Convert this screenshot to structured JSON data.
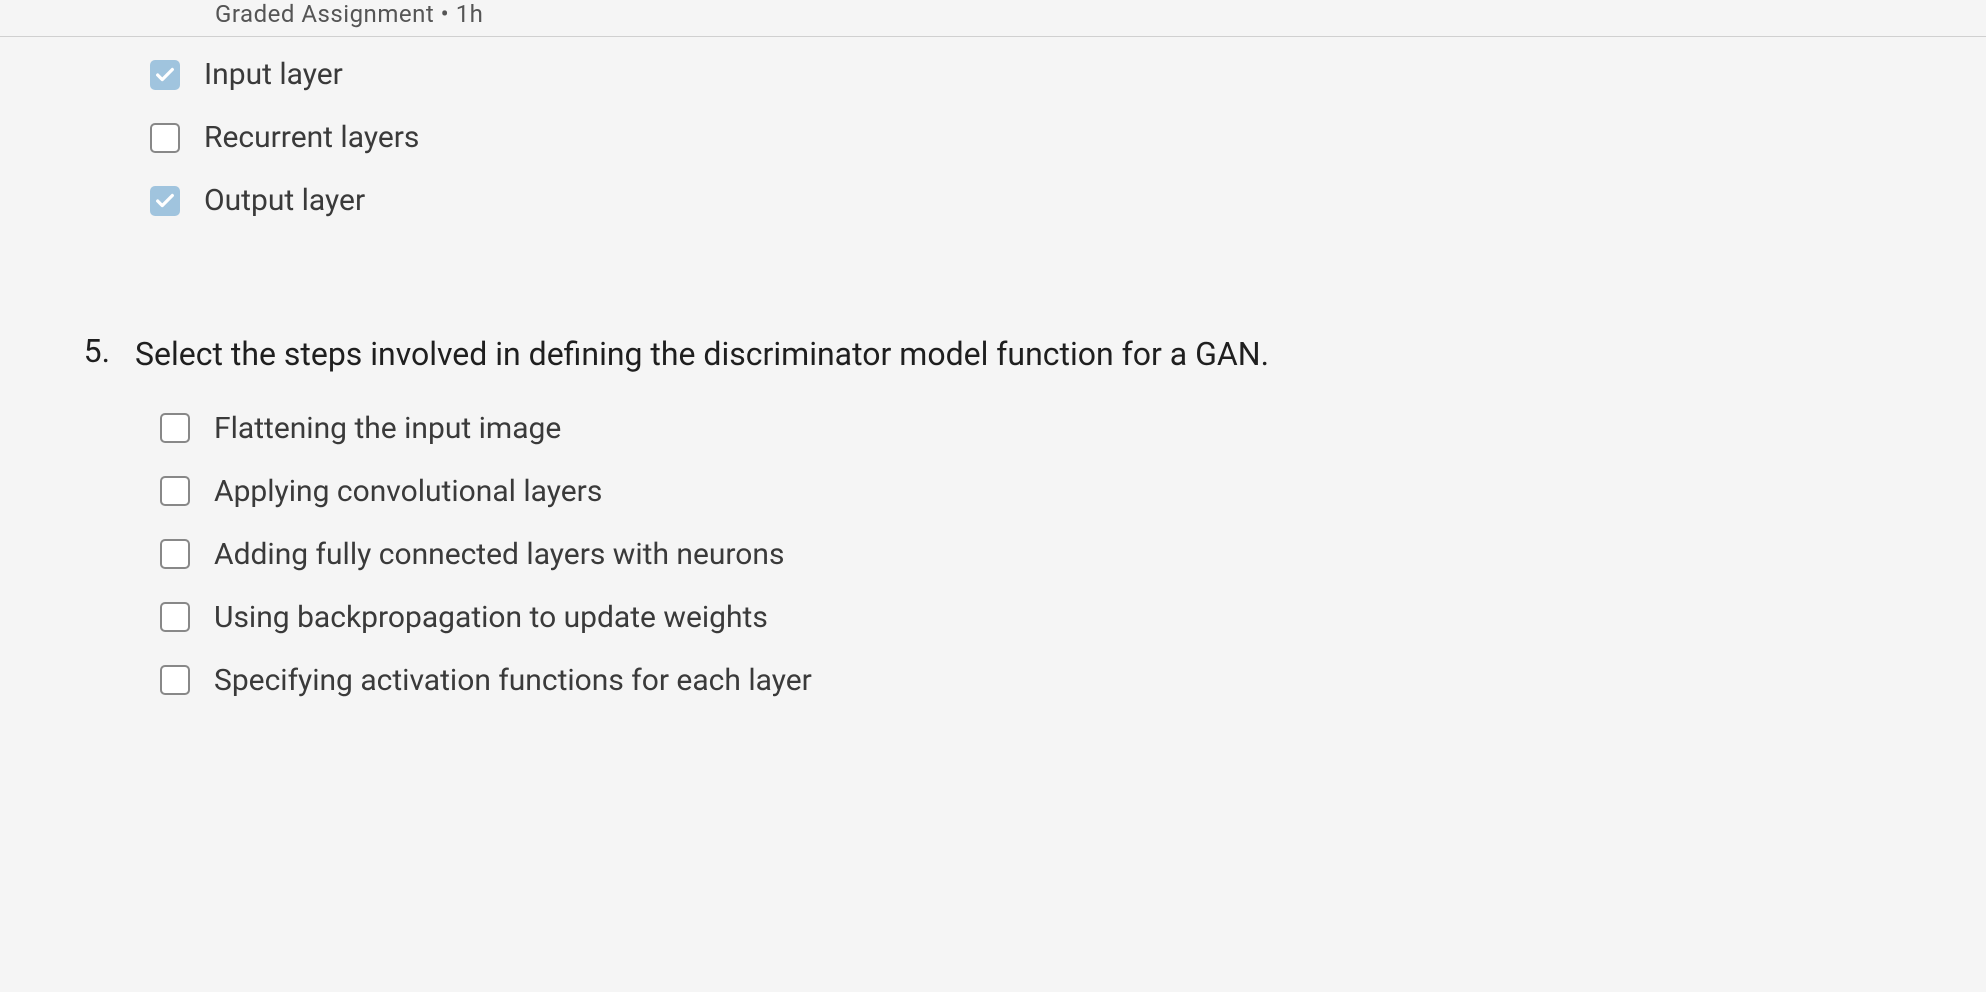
{
  "header": {
    "breadcrumb": "Graded Assignment • 1h"
  },
  "question4": {
    "options": [
      {
        "label": "Input layer",
        "checked": true
      },
      {
        "label": "Recurrent layers",
        "checked": false
      },
      {
        "label": "Output layer",
        "checked": true
      }
    ]
  },
  "question5": {
    "number": "5.",
    "text": "Select the steps involved in defining the discriminator model function for a GAN.",
    "options": [
      {
        "label": "Flattening the input image",
        "checked": false
      },
      {
        "label": "Applying convolutional layers",
        "checked": false
      },
      {
        "label": "Adding fully connected layers with neurons",
        "checked": false
      },
      {
        "label": "Using backpropagation to update weights",
        "checked": false
      },
      {
        "label": "Specifying activation functions for each layer",
        "checked": false
      }
    ]
  }
}
